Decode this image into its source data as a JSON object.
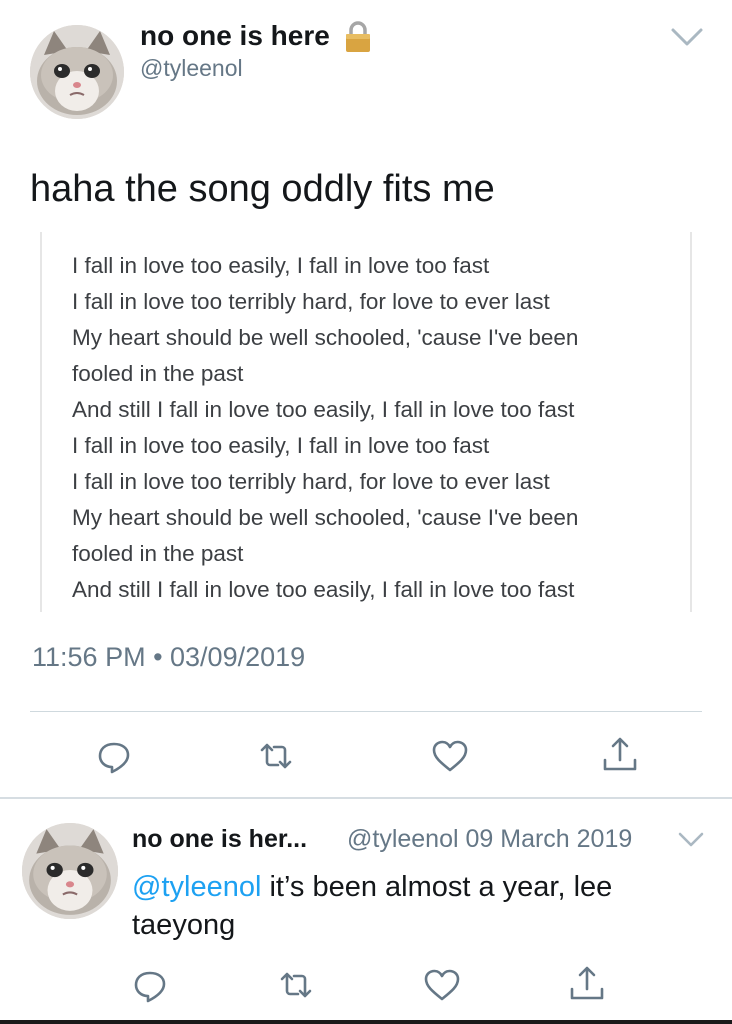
{
  "tweet": {
    "display_name": "no one is here",
    "handle": "@tyleenol",
    "text": "haha the song oddly fits me",
    "lyrics": [
      "I fall in love too easily, I fall in love too fast",
      "I fall in love too terribly hard, for love to ever last",
      "My heart should be well schooled, 'cause I've been",
      "fooled in the past",
      "And still I fall in love too easily, I fall in love too fast",
      "I fall in love too easily, I fall in love too fast",
      "I fall in love too terribly hard, for love to ever last",
      "My heart should be well schooled, 'cause I've been",
      "fooled in the past",
      "And still I fall in love too easily, I fall in love too fast"
    ],
    "timestamp": "11:56 PM • 03/09/2019",
    "icons": {
      "protected": "lock-icon",
      "menu": "chevron-down-icon",
      "reply": "reply-icon",
      "retweet": "retweet-icon",
      "like": "heart-icon",
      "share": "share-icon"
    }
  },
  "reply": {
    "display_name": "no one is her...",
    "handle_date": "@tyleenol 09 March 2019",
    "mention": "@tyleenol",
    "text": " it’s been almost a year, lee taeyong"
  },
  "colors": {
    "link": "#1da1f2",
    "secondary_text": "#657786",
    "icon": "#657786"
  }
}
